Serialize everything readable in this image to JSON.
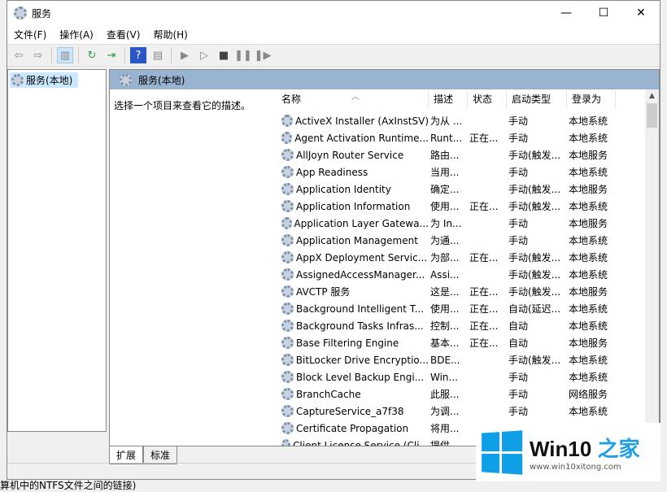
{
  "window": {
    "title": "服务",
    "controls": {
      "minimize": "—",
      "maximize": "☐",
      "close": "✕"
    }
  },
  "menu": [
    "文件(F)",
    "操作(A)",
    "查看(V)",
    "帮助(H)"
  ],
  "toolbar": [
    {
      "icon": "back-icon",
      "glyph": "⇦"
    },
    {
      "icon": "forward-icon",
      "glyph": "⇨"
    },
    {
      "icon": "show-hide-tree-icon",
      "glyph": "▥"
    },
    {
      "icon": "refresh-icon",
      "glyph": "↻"
    },
    {
      "icon": "export-list-icon",
      "glyph": "⇥"
    },
    {
      "icon": "help-icon",
      "glyph": "?"
    },
    {
      "icon": "properties-icon",
      "glyph": "▤"
    },
    {
      "icon": "start-icon",
      "glyph": "▶"
    },
    {
      "icon": "start-alt-icon",
      "glyph": "▷"
    },
    {
      "icon": "stop-icon",
      "glyph": "■"
    },
    {
      "icon": "pause-icon",
      "glyph": "❚❚"
    },
    {
      "icon": "restart-icon",
      "glyph": "❚▶"
    }
  ],
  "tree": {
    "item": "服务(本地)"
  },
  "panel": {
    "title": "服务(本地)",
    "description": "选择一个项目来查看它的描述。"
  },
  "columns": [
    "名称",
    "描述",
    "状态",
    "启动类型",
    "登录为"
  ],
  "rows": [
    [
      "ActiveX Installer (AxInstSV)",
      "为从 ...",
      "",
      "手动",
      "本地系统"
    ],
    [
      "Agent Activation Runtime...",
      "Runt...",
      "正在...",
      "手动",
      "本地系统"
    ],
    [
      "AllJoyn Router Service",
      "路由...",
      "",
      "手动(触发...",
      "本地服务"
    ],
    [
      "App Readiness",
      "当用...",
      "",
      "手动",
      "本地系统"
    ],
    [
      "Application Identity",
      "确定...",
      "",
      "手动(触发...",
      "本地服务"
    ],
    [
      "Application Information",
      "使用...",
      "正在...",
      "手动(触发...",
      "本地系统"
    ],
    [
      "Application Layer Gatewa...",
      "为 In...",
      "",
      "手动",
      "本地服务"
    ],
    [
      "Application Management",
      "为通...",
      "",
      "手动",
      "本地系统"
    ],
    [
      "AppX Deployment Servic...",
      "为部...",
      "正在...",
      "手动(触发...",
      "本地系统"
    ],
    [
      "AssignedAccessManager...",
      "Assi...",
      "",
      "手动(触发...",
      "本地系统"
    ],
    [
      "AVCTP 服务",
      "这是...",
      "正在...",
      "手动(触发...",
      "本地服务"
    ],
    [
      "Background Intelligent T...",
      "使用...",
      "正在...",
      "自动(延迟...",
      "本地系统"
    ],
    [
      "Background Tasks Infras...",
      "控制...",
      "正在...",
      "自动",
      "本地系统"
    ],
    [
      "Base Filtering Engine",
      "基本...",
      "正在...",
      "自动",
      "本地服务"
    ],
    [
      "BitLocker Drive Encryptio...",
      "BDE...",
      "",
      "手动(触发...",
      "本地系统"
    ],
    [
      "Block Level Backup Engi...",
      "Win...",
      "",
      "手动",
      "本地系统"
    ],
    [
      "BranchCache",
      "此服...",
      "",
      "手动",
      "网络服务"
    ],
    [
      "CaptureService_a7f38",
      "为调...",
      "",
      "手动",
      "本地系统"
    ],
    [
      "Certificate Propagation",
      "将用...",
      "",
      "",
      ""
    ],
    [
      "Client License Service (Cli...",
      "提供...",
      "",
      "",
      ""
    ]
  ],
  "tabs": [
    "扩展",
    "标准"
  ],
  "background_text": "算机中的NTFS文件之间的链接)",
  "watermark": {
    "brand": "Win10",
    "brand_accent": "之家",
    "url": "www.win10xitong.com"
  },
  "colors": {
    "panel_header": "#99b4d1",
    "selection": "#cce8ff",
    "logo_blue": "#0e9fe6"
  }
}
